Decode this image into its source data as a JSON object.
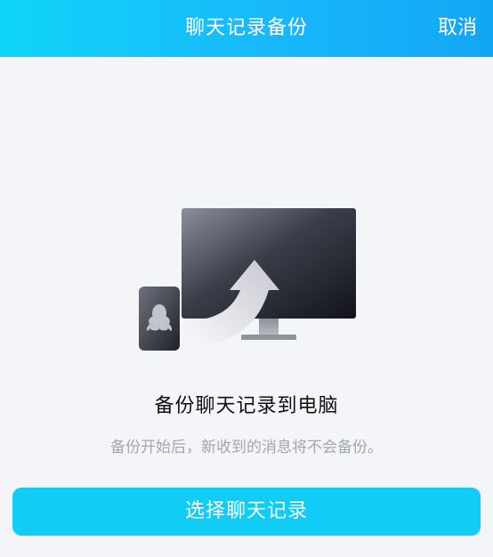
{
  "header": {
    "title": "聊天记录备份",
    "cancel_label": "取消"
  },
  "main": {
    "headline": "备份聊天记录到电脑",
    "description": "备份开始后，新收到的消息将不会备份。",
    "primary_button_label": "选择聊天记录"
  },
  "icons": {
    "illustration": "phone-to-desktop-upload-icon",
    "phone": "phone-icon",
    "qq_logo": "qq-penguin-icon",
    "monitor": "desktop-monitor-icon",
    "arrow": "upload-arrow-icon"
  },
  "colors": {
    "header_gradient_start": "#10d4f8",
    "header_gradient_end": "#12a6f5",
    "primary_button": "#11cdf6",
    "background": "#f4f5f9",
    "headline_text": "#111111",
    "description_text": "#a3a6ad"
  }
}
